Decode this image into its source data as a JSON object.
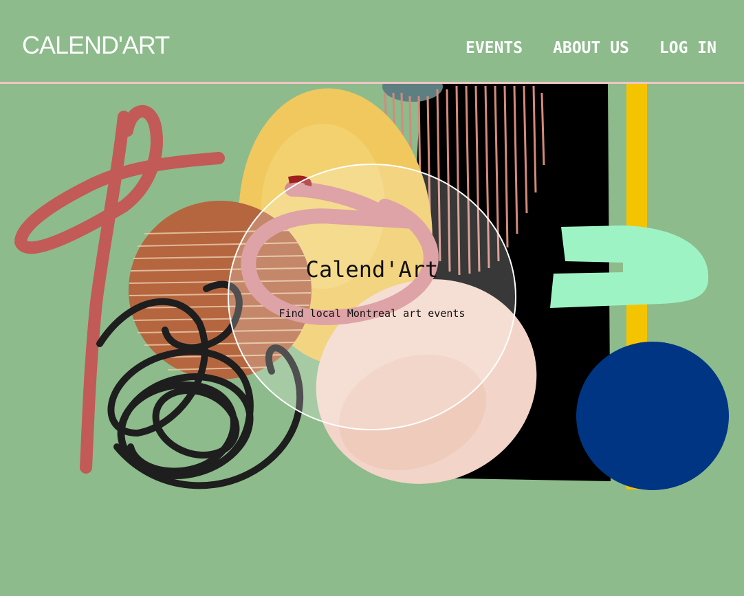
{
  "header": {
    "logo": "CALEND'ART",
    "nav": [
      {
        "label": "EVENTS"
      },
      {
        "label": "ABOUT US"
      },
      {
        "label": "LOG IN"
      }
    ]
  },
  "hero": {
    "title": "Calend'Art",
    "subtitle": "Find local Montreal art events"
  },
  "colors": {
    "background": "#8dbb8b",
    "header_rule": "#f0c6c6",
    "text_light": "#ffffff",
    "text_dark": "#111111",
    "art_red": "#c25a57",
    "art_yellow": "#f0c85e",
    "art_brown": "#b5663f",
    "art_black": "#000000",
    "art_mint": "#9ef3c5",
    "art_gold": "#f5c400",
    "art_navy": "#003583",
    "art_pink": "#d48a8e",
    "art_peach": "#f2d5c8"
  }
}
